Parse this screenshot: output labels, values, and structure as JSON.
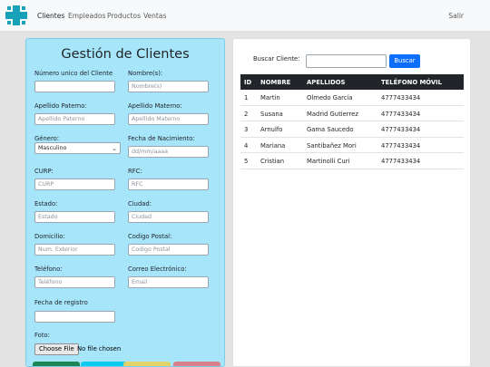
{
  "nav": {
    "items": [
      {
        "label": "Clientes",
        "active": true
      },
      {
        "label": "Empleados",
        "active": false
      },
      {
        "label": "Productos",
        "active": false
      },
      {
        "label": "Ventas",
        "active": false
      }
    ],
    "logout": "Salir",
    "brand_color": "#17a2b8"
  },
  "form": {
    "title": "Gestión de Clientes",
    "numero_label": "Número unico del Cliente",
    "nombres_label": "Nombre(s):",
    "nombres_placeholder": "Nombre(s)",
    "ap_paterno_label": "Apellido Paterno:",
    "ap_paterno_placeholder": "Apellido Paterno",
    "ap_materno_label": "Apellido Materno:",
    "ap_materno_placeholder": "Apellido Materno",
    "genero_label": "Género:",
    "genero_value": "Masculino",
    "fecha_nac_label": "Fecha de Nacimiento:",
    "fecha_nac_placeholder": "dd/mm/aaaa",
    "curp_label": "CURP:",
    "curp_placeholder": "CURP",
    "rfc_label": "RFC:",
    "rfc_placeholder": "RFC",
    "estado_label": "Estado:",
    "estado_placeholder": "Estado",
    "ciudad_label": "Ciudad:",
    "ciudad_placeholder": "Ciudad",
    "domicilio_label": "Domicilio:",
    "domicilio_placeholder": "Num. Exterior",
    "cp_label": "Codigo Postal:",
    "cp_placeholder": "Codigo Postal",
    "telefono_label": "Teléfono:",
    "telefono_placeholder": "Teléfono",
    "email_label": "Correo Electrónico:",
    "email_placeholder": "Email",
    "fecha_reg_label": "Fecha de registro",
    "foto_label": "Foto:",
    "file_button": "Choose File",
    "file_status": "No file chosen",
    "panel_color": "#a7e5fb",
    "button_colors": [
      "#198754",
      "#0dcaf0",
      "#e2d26a",
      "#d77f8a"
    ]
  },
  "search": {
    "label": "Buscar Cliente:",
    "button": "Buscar"
  },
  "table": {
    "headers": [
      "ID",
      "NOMBRE",
      "APELLIDOS",
      "TELÉFONO MÓVIL"
    ],
    "rows": [
      [
        "1",
        "Martin",
        "Olmedo García",
        "4777433434"
      ],
      [
        "2",
        "Susana",
        "Madrid Gutierrez",
        "4777433434"
      ],
      [
        "3",
        "Arnulfo",
        "Gama Saucedo",
        "4777433434"
      ],
      [
        "4",
        "Mariana",
        "Santibañez Mori",
        "4777433434"
      ],
      [
        "5",
        "Cristian",
        "Martinolli Curi",
        "4777433434"
      ]
    ]
  }
}
